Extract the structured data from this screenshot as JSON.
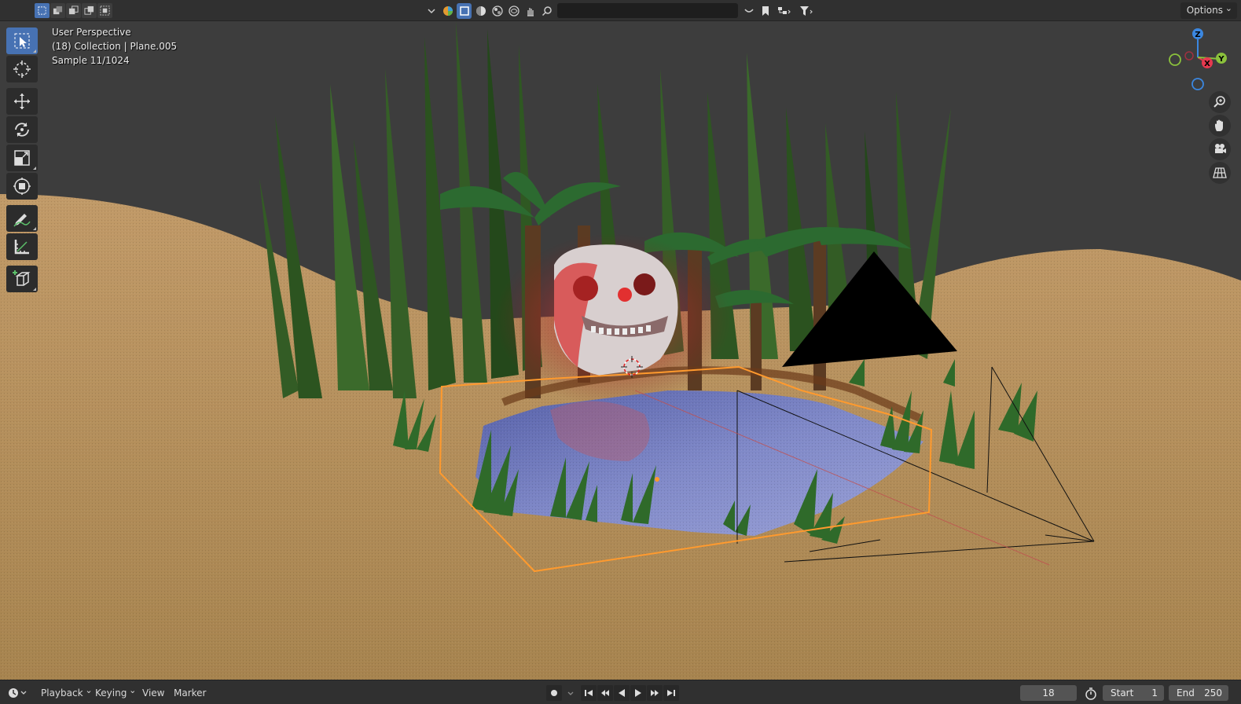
{
  "viewport": {
    "view_name": "User Perspective",
    "collection_info": "(18) Collection | Plane.005",
    "sample_info": "Sample 11/1024"
  },
  "header": {
    "options_label": "Options",
    "search_placeholder": ""
  },
  "gizmo": {
    "x_label": "X",
    "y_label": "Y",
    "z_label": "Z",
    "colors": {
      "x": "#e6394f",
      "y": "#8bc13c",
      "z": "#3b87e0"
    }
  },
  "toolbar": {
    "tools": [
      "select-box",
      "cursor",
      "move",
      "rotate",
      "scale",
      "transform",
      "annotate",
      "measure",
      "add-cube"
    ],
    "active_tool": "select-box"
  },
  "timeline": {
    "menus": {
      "playback": "Playback",
      "keying": "Keying",
      "view": "View",
      "marker": "Marker"
    },
    "current_frame": "18",
    "start_label": "Start",
    "start_value": "1",
    "end_label": "End",
    "end_value": "250"
  },
  "colors": {
    "accent": "#4772b3",
    "header_bg": "#303030",
    "viewport_bg": "#3d3d3d",
    "selection_outline": "#ff9a2e",
    "sand": "#b58f5c"
  }
}
